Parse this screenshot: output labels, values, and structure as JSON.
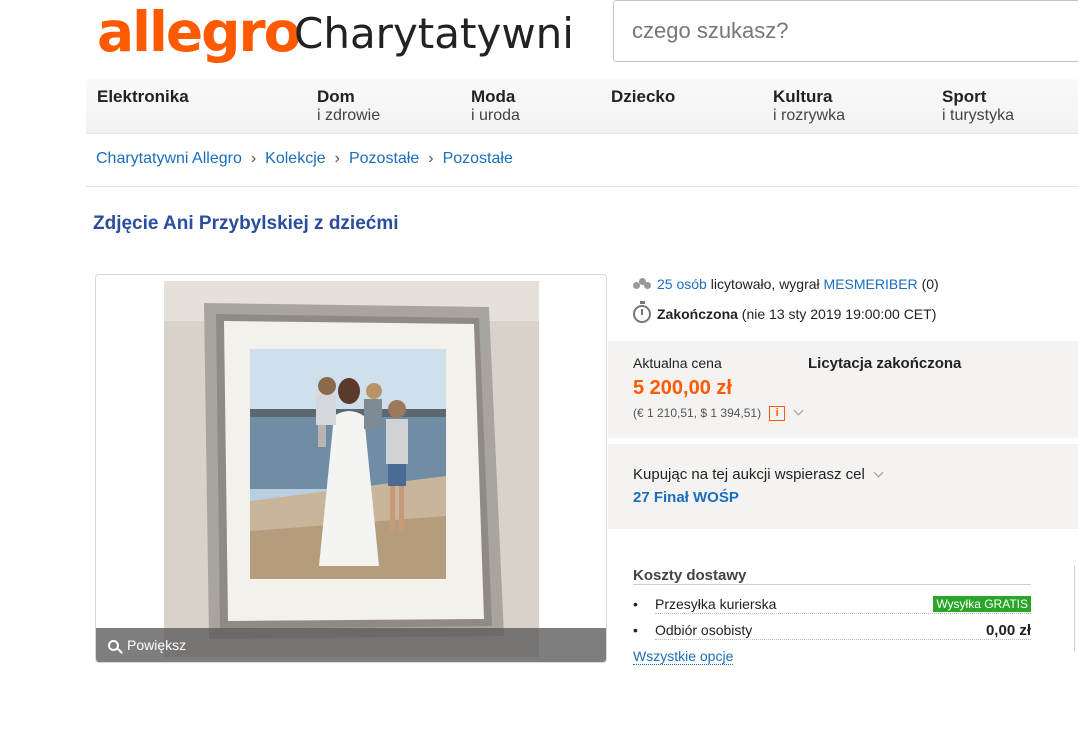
{
  "header": {
    "logo": "allegro",
    "logo_sub": "Charytatywni",
    "search_placeholder": "czego szukasz?"
  },
  "nav": [
    {
      "main": "Elektronika",
      "sub": ""
    },
    {
      "main": "Dom",
      "sub": "i zdrowie"
    },
    {
      "main": "Moda",
      "sub": "i uroda"
    },
    {
      "main": "Dziecko",
      "sub": ""
    },
    {
      "main": "Kultura",
      "sub": "i rozrywka"
    },
    {
      "main": "Sport",
      "sub": "i turystyka"
    }
  ],
  "breadcrumb": [
    "Charytatywni Allegro",
    "Kolekcje",
    "Pozostałe",
    "Pozostałe"
  ],
  "breadcrumb_sep": "›",
  "title": "Zdjęcie Ani Przybylskiej z dziećmi",
  "image": {
    "zoom_label": "Powiększ"
  },
  "bids": {
    "count_link": "25 osób",
    "text": "licytowało, wygrał",
    "winner": "MESMERIBER",
    "winner_score": "(0)"
  },
  "status": {
    "label": "Zakończona",
    "date": "(nie 13 sty 2019 19:00:00 CET)"
  },
  "price": {
    "label": "Aktualna cena",
    "auction_status": "Licytacja zakończona",
    "value": "5 200,00 zł",
    "conversion": "(€ 1 210,51, $ 1 394,51)",
    "info_icon": "i"
  },
  "cause": {
    "text": "Kupując na tej aukcji wspierasz cel",
    "link": "27 Finał WOŚP"
  },
  "shipping": {
    "title": "Koszty dostawy",
    "rows": [
      {
        "bullet": "•",
        "name": "Przesyłka kurierska",
        "badge": "Wysyłka GRATIS"
      },
      {
        "bullet": "•",
        "name": "Odbiór osobisty",
        "price": "0,00 zł"
      }
    ],
    "all_options": "Wszystkie opcje"
  },
  "colors": {
    "brand": "#ff5a00",
    "link": "#1a6ebc",
    "title": "#2a4d9e",
    "gratis": "#2aa52a"
  }
}
